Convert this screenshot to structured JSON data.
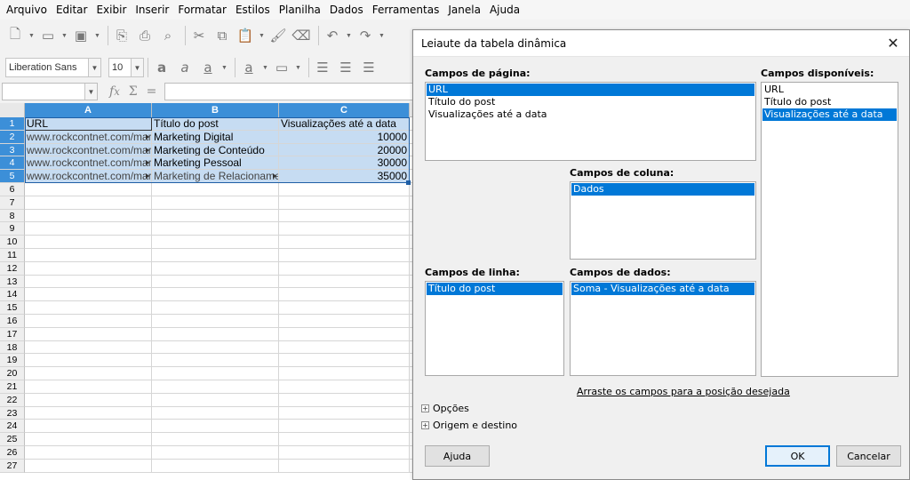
{
  "menubar": {
    "items": [
      "Arquivo",
      "Editar",
      "Exibir",
      "Inserir",
      "Formatar",
      "Estilos",
      "Planilha",
      "Dados",
      "Ferramentas",
      "Janela",
      "Ajuda"
    ]
  },
  "toolbar": {
    "font_name": "Liberation Sans",
    "font_size": "10"
  },
  "formula_bar": {
    "name_box": "",
    "content": "",
    "function_wizard_icon": "fx-icon",
    "sum_icon": "sum-icon",
    "formula_icon": "equals-icon"
  },
  "sheet": {
    "columns": [
      "A",
      "B",
      "C"
    ],
    "rows": [
      {
        "n": "1",
        "a": "URL",
        "b": "Título do post",
        "c": "Visualizações até a data"
      },
      {
        "n": "2",
        "a": "www.rockcontnet.com/mar",
        "b": "Marketing Digital",
        "c": "10000"
      },
      {
        "n": "3",
        "a": "www.rockcontnet.com/mar",
        "b": "Marketing de Conteúdo",
        "c": "20000"
      },
      {
        "n": "4",
        "a": "www.rockcontnet.com/mar",
        "b": "Marketing Pessoal",
        "c": "30000"
      },
      {
        "n": "5",
        "a": "www.rockcontnet.com/mar",
        "b": "Marketing de Relacionamer",
        "c": "35000"
      },
      {
        "n": "6",
        "a": "",
        "b": "",
        "c": ""
      },
      {
        "n": "7",
        "a": "",
        "b": "",
        "c": ""
      },
      {
        "n": "8",
        "a": "",
        "b": "",
        "c": ""
      },
      {
        "n": "9",
        "a": "",
        "b": "",
        "c": ""
      },
      {
        "n": "10",
        "a": "",
        "b": "",
        "c": ""
      },
      {
        "n": "11",
        "a": "",
        "b": "",
        "c": ""
      },
      {
        "n": "12",
        "a": "",
        "b": "",
        "c": ""
      },
      {
        "n": "13",
        "a": "",
        "b": "",
        "c": ""
      },
      {
        "n": "14",
        "a": "",
        "b": "",
        "c": ""
      },
      {
        "n": "15",
        "a": "",
        "b": "",
        "c": ""
      },
      {
        "n": "16",
        "a": "",
        "b": "",
        "c": ""
      },
      {
        "n": "17",
        "a": "",
        "b": "",
        "c": ""
      },
      {
        "n": "18",
        "a": "",
        "b": "",
        "c": ""
      },
      {
        "n": "19",
        "a": "",
        "b": "",
        "c": ""
      },
      {
        "n": "20",
        "a": "",
        "b": "",
        "c": ""
      },
      {
        "n": "21",
        "a": "",
        "b": "",
        "c": ""
      },
      {
        "n": "22",
        "a": "",
        "b": "",
        "c": ""
      },
      {
        "n": "23",
        "a": "",
        "b": "",
        "c": ""
      },
      {
        "n": "24",
        "a": "",
        "b": "",
        "c": ""
      },
      {
        "n": "25",
        "a": "",
        "b": "",
        "c": ""
      },
      {
        "n": "26",
        "a": "",
        "b": "",
        "c": ""
      },
      {
        "n": "27",
        "a": "",
        "b": "",
        "c": ""
      }
    ]
  },
  "dialog": {
    "title": "Leiaute da tabela dinâmica",
    "page_fields": {
      "label": "Campos de página:",
      "items": [
        "URL",
        "Título do post",
        "Visualizações até a data"
      ],
      "selected": 0
    },
    "column_fields": {
      "label": "Campos de coluna:",
      "items": [
        "Dados"
      ],
      "selected": 0
    },
    "row_fields": {
      "label": "Campos de linha:",
      "items": [
        "Título do post"
      ],
      "selected": 0
    },
    "data_fields": {
      "label": "Campos de dados:",
      "items": [
        "Soma - Visualizações até a data"
      ],
      "selected": 0
    },
    "available_fields": {
      "label": "Campos disponíveis:",
      "items": [
        "URL",
        "Título do post",
        "Visualizações até a data"
      ],
      "selected": 2
    },
    "hint": "Arraste os campos para a posição desejada",
    "options_label": "Opções",
    "source_label": "Origem e destino",
    "help_button": "Ajuda",
    "ok_button": "OK",
    "cancel_button": "Cancelar"
  },
  "colors": {
    "selection_blue": "#0078d7",
    "header_selected": "#3c8fd8",
    "cell_selected": "#c6dcf2"
  }
}
